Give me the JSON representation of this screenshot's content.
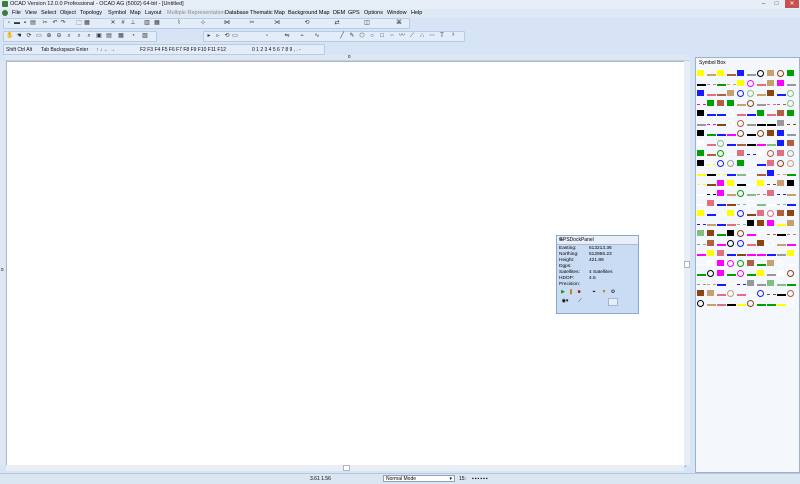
{
  "titlebar": {
    "title": "OCAD Version 12.0.0  Professional  - OCAD AG (5002) 64-bit - [Untitled]",
    "minimize": "–",
    "maximize": "□",
    "close": "✕"
  },
  "menu": [
    "File",
    "View",
    "Select",
    "Object",
    "Topology",
    "Symbol",
    "Map",
    "Layout",
    "Multiple Representation",
    "Database",
    "Thematic Map",
    "Background Map",
    "DEM",
    "GPS",
    "Options",
    "Window",
    "Help"
  ],
  "keyboard_toolbar": {
    "modifiers": "Shift  Ctrl  Alt",
    "keys": "Tab  Backspace  Enter",
    "arrows": "↑  ↓  ←  →",
    "fkeys": "F2  F3  F4  F5  F6  F7  F8  F9  F10  F11  F12",
    "digits": "0  1  2  3  4  5  6  7  8  9  ,  .  -"
  },
  "ruler": {
    "top_label": "0",
    "left_label": "0"
  },
  "symbol_box": {
    "title": "Symbol Box"
  },
  "gps_panel": {
    "title": "GPSDockPanel",
    "close": "✕",
    "rows": [
      {
        "label": "Easting:",
        "value": "613213.36"
      },
      {
        "label": "Northing:",
        "value": "512956.23"
      },
      {
        "label": "Height:",
        "value": "421.89"
      },
      {
        "label": "Dgps:",
        "value": ""
      },
      {
        "label": "Satellites:",
        "value": "4 Satellites"
      },
      {
        "label": "HDOP:",
        "value": "4.5"
      },
      {
        "label": "Precision:",
        "value": ""
      }
    ]
  },
  "status": {
    "coords": "3.61   1.56",
    "mode": "Normal Mode",
    "scale": "15:"
  },
  "colors": {
    "accent": "#3a7d3a",
    "close_button": "#c75050"
  }
}
